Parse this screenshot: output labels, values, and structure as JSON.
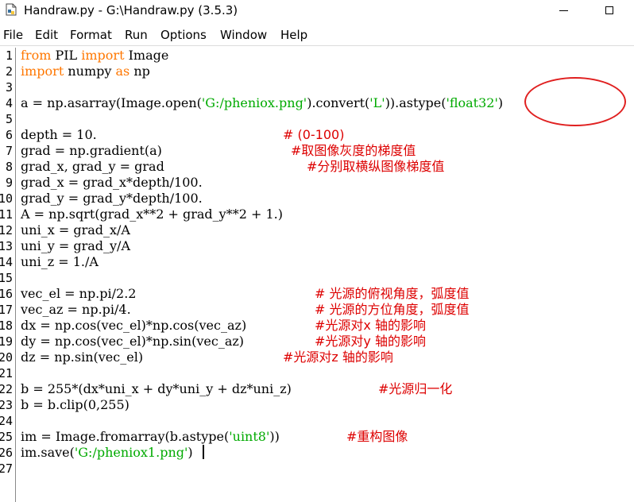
{
  "window": {
    "title": "Handraw.py - G:\\Handraw.py (3.5.3)",
    "icon": "python-file-icon"
  },
  "menu": {
    "items": [
      "File",
      "Edit",
      "Format",
      "Run",
      "Options",
      "Window",
      "Help"
    ]
  },
  "editor": {
    "line_numbers": [
      "1",
      "2",
      "3",
      "4",
      "5",
      "6",
      "7",
      "8",
      "9",
      "10",
      "11",
      "12",
      "13",
      "14",
      "15",
      "16",
      "17",
      "18",
      "19",
      "20",
      "21",
      "22",
      "23",
      "24",
      "25",
      "26",
      "27"
    ],
    "lines": [
      {
        "segs": [
          {
            "t": "from",
            "k": "kw"
          },
          {
            "t": " PIL "
          },
          {
            "t": "import",
            "k": "kw"
          },
          {
            "t": " Image"
          }
        ]
      },
      {
        "segs": [
          {
            "t": "import",
            "k": "kw"
          },
          {
            "t": " numpy "
          },
          {
            "t": "as",
            "k": "kw"
          },
          {
            "t": " np"
          }
        ]
      },
      {
        "segs": []
      },
      {
        "segs": [
          {
            "t": "a = np.asarray(Image.open("
          },
          {
            "t": "'G:/pheniox.png'",
            "k": "str"
          },
          {
            "t": ").convert("
          },
          {
            "t": "'L'",
            "k": "str"
          },
          {
            "t": ")).astype("
          },
          {
            "t": "'float32'",
            "k": "str"
          },
          {
            "t": ")"
          }
        ]
      },
      {
        "segs": []
      },
      {
        "segs": [
          {
            "t": "depth = 10."
          }
        ],
        "comment": "# (0-100)"
      },
      {
        "segs": [
          {
            "t": "grad = np.gradient(a)"
          }
        ],
        "comment": "#取图像灰度的梯度值"
      },
      {
        "segs": [
          {
            "t": "grad_x, grad_y = grad"
          }
        ],
        "comment": "#分别取横纵图像梯度值"
      },
      {
        "segs": [
          {
            "t": "grad_x = grad_x*depth/100."
          }
        ]
      },
      {
        "segs": [
          {
            "t": "grad_y = grad_y*depth/100."
          }
        ]
      },
      {
        "segs": [
          {
            "t": "A = np.sqrt(grad_x**2 + grad_y**2 + 1.)"
          }
        ]
      },
      {
        "segs": [
          {
            "t": "uni_x = grad_x/A"
          }
        ]
      },
      {
        "segs": [
          {
            "t": "uni_y = grad_y/A"
          }
        ]
      },
      {
        "segs": [
          {
            "t": "uni_z = 1./A"
          }
        ]
      },
      {
        "segs": []
      },
      {
        "segs": [
          {
            "t": "vec_el = np.pi/2.2"
          }
        ],
        "comment": "# 光源的俯视角度，弧度值"
      },
      {
        "segs": [
          {
            "t": "vec_az = np.pi/4."
          }
        ],
        "comment": "# 光源的方位角度，弧度值"
      },
      {
        "segs": [
          {
            "t": "dx = np.cos(vec_el)*np.cos(vec_az)"
          }
        ],
        "comment": "#光源对x 轴的影响"
      },
      {
        "segs": [
          {
            "t": "dy = np.cos(vec_el)*np.sin(vec_az)"
          }
        ],
        "comment": "#光源对y 轴的影响"
      },
      {
        "segs": [
          {
            "t": "dz = np.sin(vec_el)"
          }
        ],
        "comment": "#光源对z 轴的影响"
      },
      {
        "segs": []
      },
      {
        "segs": [
          {
            "t": "b = 255*(dx*uni_x + dy*uni_y + dz*uni_z)"
          }
        ],
        "comment": "#光源归一化"
      },
      {
        "segs": [
          {
            "t": "b = b.clip(0,255)"
          }
        ]
      },
      {
        "segs": []
      },
      {
        "segs": [
          {
            "t": "im = Image.fromarray(b.astype("
          },
          {
            "t": "'uint8'",
            "k": "str"
          },
          {
            "t": "))"
          }
        ],
        "comment": "#重构图像"
      },
      {
        "segs": [
          {
            "t": "im.save("
          },
          {
            "t": "'G:/pheniox1.png'",
            "k": "str"
          },
          {
            "t": ")"
          }
        ]
      },
      {
        "segs": []
      }
    ]
  },
  "colors": {
    "keyword": "#ff7700",
    "string": "#00aa00",
    "comment": "#dd0000",
    "annotation": "#e02020"
  }
}
